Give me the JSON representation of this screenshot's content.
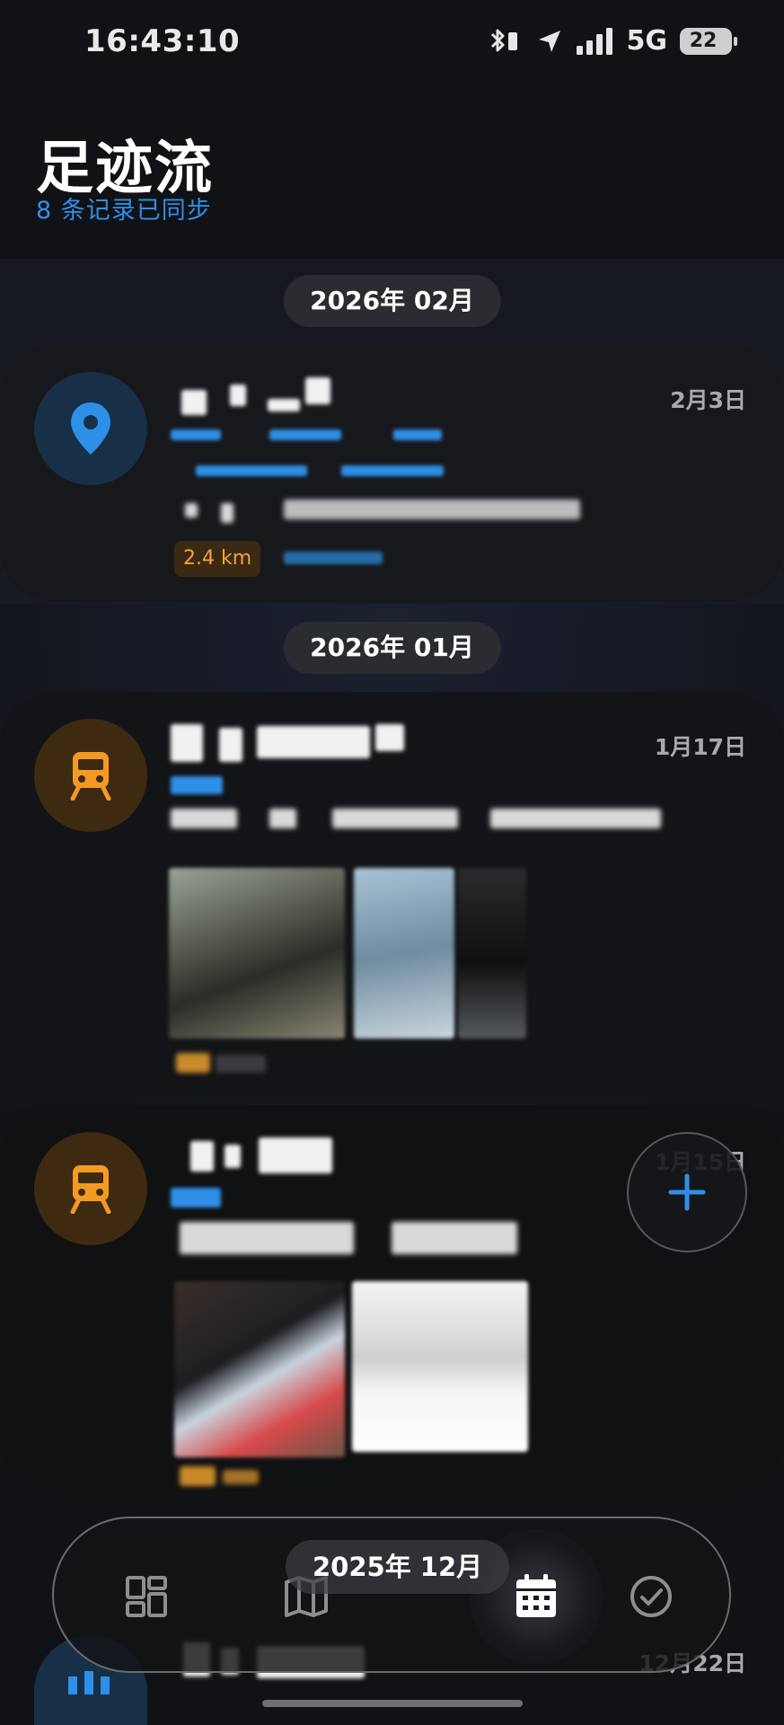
{
  "status_bar": {
    "time": "16:43:10",
    "network": "5G",
    "battery": "22",
    "icons": [
      "bluetooth-icon",
      "location-arrow-icon",
      "signal-icon",
      "battery-icon"
    ]
  },
  "header": {
    "title": "足迹流",
    "subtitle": "8 条记录已同步"
  },
  "timeline": [
    {
      "month": "2026年 02月",
      "entries": [
        {
          "date": "2月3日",
          "icon": "map-pin-icon",
          "distance": "2.4 km"
        }
      ]
    },
    {
      "month": "2026年 01月",
      "entries": [
        {
          "date": "1月17日",
          "icon": "train-icon"
        },
        {
          "date": "1月15日",
          "icon": "train-icon"
        }
      ]
    },
    {
      "month": "2025年 12月",
      "entries": [
        {
          "date": "12月22日",
          "icon": "map-pin-icon"
        }
      ]
    }
  ],
  "fab": {
    "icon": "plus-icon"
  },
  "bottom_nav": {
    "items": [
      {
        "icon": "dashboard-icon",
        "active": false
      },
      {
        "icon": "map-icon",
        "active": false
      },
      {
        "icon": "calendar-icon",
        "active": true
      },
      {
        "icon": "check-circle-icon",
        "active": false
      }
    ]
  },
  "colors": {
    "accent": "#2f8fe8",
    "orange": "#f2a33a",
    "background": "#111215"
  }
}
